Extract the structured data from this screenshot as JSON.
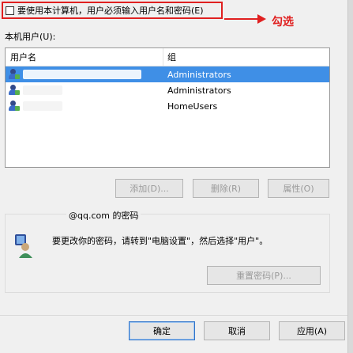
{
  "checkbox": {
    "label": "要使用本计算机，用户必须输入用户名和密码(E)",
    "checked": false
  },
  "annotation": {
    "text": "勾选",
    "color": "#e02020"
  },
  "users_label": "本机用户(U):",
  "table": {
    "headers": [
      "用户名",
      "组"
    ],
    "rows": [
      {
        "user": "",
        "group": "Administrators",
        "selected": true
      },
      {
        "user": "",
        "group": "Administrators",
        "selected": false
      },
      {
        "user": "",
        "group": "HomeUsers",
        "selected": false
      }
    ]
  },
  "actions": {
    "add": "添加(D)...",
    "remove": "删除(R)",
    "properties": "属性(O)"
  },
  "password_group": {
    "title": "@qq.com 的密码",
    "message": "要更改你的密码，请转到\"电脑设置\"，然后选择\"用户\"。",
    "reset": "重置密码(P)..."
  },
  "footer": {
    "ok": "确定",
    "cancel": "取消",
    "apply": "应用(A)"
  },
  "colors": {
    "selection": "#3f8fe6",
    "callout": "#e02020"
  }
}
